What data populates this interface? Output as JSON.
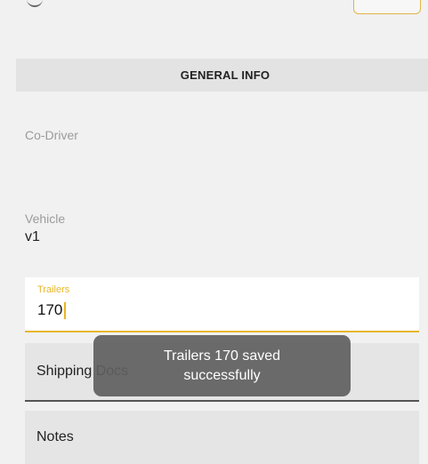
{
  "section": {
    "title": "GENERAL INFO"
  },
  "fields": {
    "co_driver": {
      "label": "Co-Driver",
      "value": ""
    },
    "vehicle": {
      "label": "Vehicle",
      "value": "v1"
    },
    "trailers": {
      "label": "Trailers",
      "value": "170"
    }
  },
  "rows": {
    "shipping_docs": "Shipping Docs",
    "notes": "Notes"
  },
  "toast": {
    "line1": "Trailers 170 saved",
    "line2": "successfully"
  },
  "colors": {
    "accent": "#e7b628",
    "toast_bg": "#5f5f5f"
  }
}
